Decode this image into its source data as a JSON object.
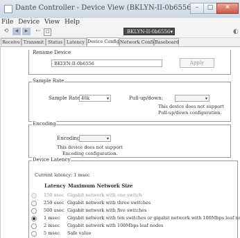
{
  "window": {
    "title": "Dante Controller - Device View (BKLYN-II-0b6556)",
    "minimize": "–",
    "maximize": "□",
    "close": "✕"
  },
  "menu": [
    "File",
    "Device",
    "View",
    "Help"
  ],
  "toolbar": {
    "icons": [
      "refresh-icon",
      "back-icon",
      "forward-icon",
      "connect-icon",
      "info-icon"
    ],
    "device_selector": "BKLYN-II-0b6556"
  },
  "tabs": [
    {
      "label": "Receive",
      "active": false
    },
    {
      "label": "Transmit",
      "active": false
    },
    {
      "label": "Status",
      "active": false
    },
    {
      "label": "Latency",
      "active": false
    },
    {
      "label": "Device Config",
      "active": true
    },
    {
      "label": "Network Config",
      "active": false
    },
    {
      "label": "Baseboard",
      "active": false
    }
  ],
  "rename_device": {
    "title": "Rename Device",
    "value": "BKLYN-II-0b6556",
    "apply_label": "Apply"
  },
  "sample_rate": {
    "title": "Sample Rate",
    "label": "Sample Rate:",
    "value": "48k",
    "pullup_label": "Pull-up/down:",
    "pullup_value": "",
    "note_line1": "This device does not support",
    "note_line2": "Pull-up/down configuration."
  },
  "encoding": {
    "title": "Encoding",
    "label": "Encoding:",
    "value": "",
    "note_line1": "This device does not support",
    "note_line2": "Encoding configuration."
  },
  "device_latency": {
    "title": "Device Latency",
    "current_label": "Current latency: 1 msec",
    "col_latency": "Latency",
    "col_network": "Maximum Network Size",
    "rows": [
      {
        "latency": "150 usec",
        "desc": "Gigabit network with one switch",
        "selected": false,
        "enabled": false
      },
      {
        "latency": "250 usec",
        "desc": "Gigabit network with three switches",
        "selected": false,
        "enabled": true
      },
      {
        "latency": "500 usec",
        "desc": "Gigabit network with five switches",
        "selected": false,
        "enabled": true
      },
      {
        "latency": "1 msec",
        "desc": "Gigabit network with ten switches or gigabit network with 100Mbps leaf nodes",
        "selected": true,
        "enabled": true
      },
      {
        "latency": "2 msec",
        "desc": "Gigabit network with 100Mbps leaf nodes",
        "selected": false,
        "enabled": true
      },
      {
        "latency": "5 msec",
        "desc": "Safe value",
        "selected": false,
        "enabled": true
      }
    ]
  }
}
